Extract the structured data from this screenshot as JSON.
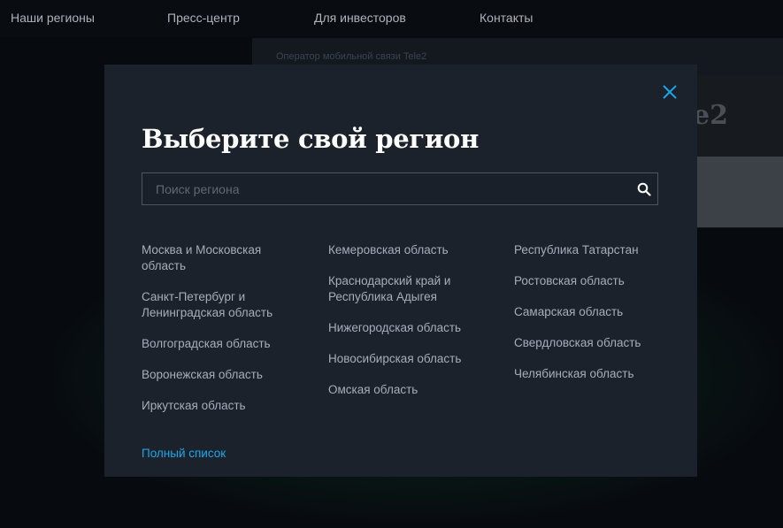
{
  "nav": {
    "items": [
      "Наши регионы",
      "Пресс-центр",
      "Для инвесторов",
      "Контакты"
    ]
  },
  "background": {
    "operator_text": "Оператор мобильной связи Tele2",
    "brand_fragment": "e2"
  },
  "modal": {
    "title": "Выберите свой регион",
    "search": {
      "placeholder": "Поиск региона",
      "value": ""
    },
    "columns": [
      [
        "Москва и Московская область",
        "Санкт-Петербург и Ленинградская область",
        "Волгоградская область",
        "Воронежская область",
        "Иркутская область"
      ],
      [
        "Кемеровская область",
        "Краснодарский край и Республика Адыгея",
        "Нижегородская область",
        "Новосибирская область",
        "Омская область"
      ],
      [
        "Республика Татарстан",
        "Ростовская область",
        "Самарская область",
        "Свердловская область",
        "Челябинская область"
      ]
    ],
    "full_list_label": "Полный список"
  },
  "icons": {
    "close": "close-icon",
    "search": "search-icon"
  },
  "colors": {
    "modal_bg": "#1b222b",
    "accent": "#18a8e8",
    "link": "#a7adba",
    "title": "#ffffff"
  }
}
